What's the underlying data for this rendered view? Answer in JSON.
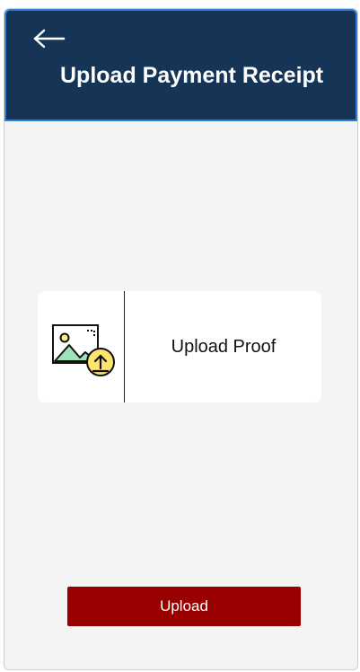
{
  "header": {
    "title": "Upload Payment Receipt",
    "back_icon": "arrow-left-icon",
    "background_color": "#163455",
    "border_color": "#2f7fd4"
  },
  "upload_card": {
    "label": "Upload Proof",
    "icon": "image-upload-icon"
  },
  "actions": {
    "upload_label": "Upload",
    "upload_color": "#990000"
  }
}
